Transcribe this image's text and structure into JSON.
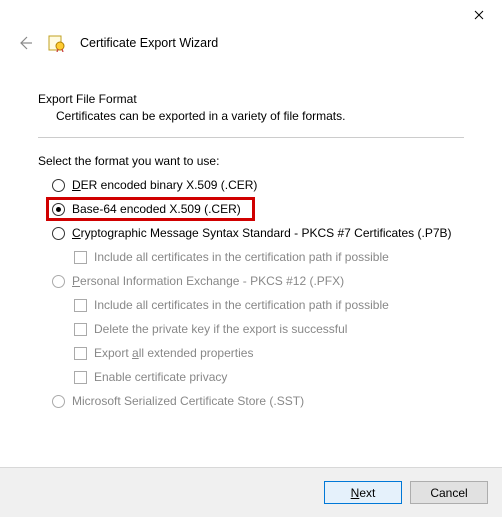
{
  "titlebar": {
    "close_name": "Close"
  },
  "header": {
    "title": "Certificate Export Wizard"
  },
  "main": {
    "section_title": "Export File Format",
    "section_desc": "Certificates can be exported in a variety of file formats.",
    "select_label": "Select the format you want to use:",
    "options": {
      "der": {
        "pre": "",
        "u": "D",
        "post": "ER encoded binary X.509 (.CER)"
      },
      "base64": {
        "label": "Base-64 encoded X.509 (.CER)"
      },
      "pkcs7": {
        "pre": "",
        "u": "C",
        "post": "ryptographic Message Syntax Standard - PKCS #7 Certificates (.P7B)"
      },
      "pkcs7_inc": {
        "label": "Include all certificates in the certification path if possible"
      },
      "pfx": {
        "pre": "",
        "u": "P",
        "post": "ersonal Information Exchange - PKCS #12 (.PFX)"
      },
      "pfx_inc": {
        "label": "Include all certificates in the certification path if possible"
      },
      "pfx_del": {
        "label": "Delete the private key if the export is successful"
      },
      "pfx_ext": {
        "pre": "Export ",
        "u": "a",
        "post": "ll extended properties"
      },
      "pfx_priv": {
        "label": "Enable certificate privacy"
      },
      "sst": {
        "label": "Microsoft Serialized Certificate Store (.SST)"
      }
    }
  },
  "footer": {
    "next": {
      "u": "N",
      "post": "ext"
    },
    "cancel": "Cancel"
  }
}
